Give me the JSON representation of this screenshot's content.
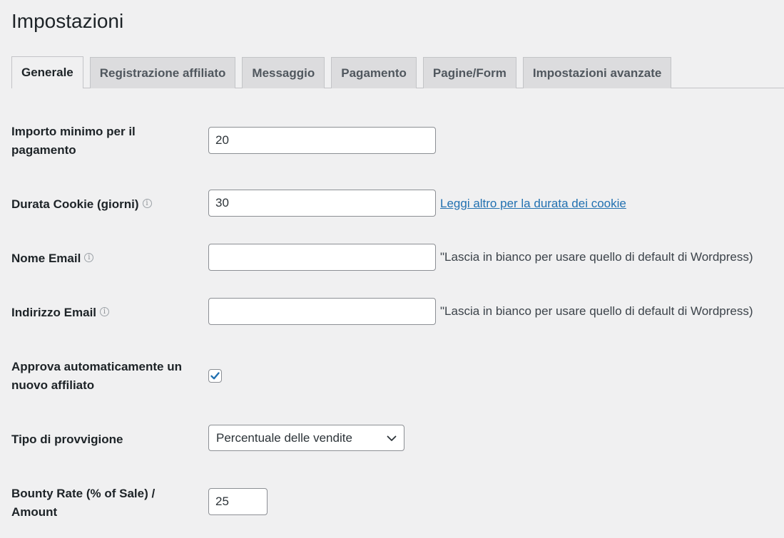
{
  "page": {
    "title": "Impostazioni"
  },
  "tabs": [
    {
      "label": "Generale",
      "active": true
    },
    {
      "label": "Registrazione affiliato"
    },
    {
      "label": "Messaggio"
    },
    {
      "label": "Pagamento"
    },
    {
      "label": "Pagine/Form"
    },
    {
      "label": "Impostazioni avanzate"
    }
  ],
  "settings": {
    "min_payout": {
      "label": "Importo minimo per il pagamento",
      "value": "20"
    },
    "cookie_duration": {
      "label": "Durata Cookie (giorni)",
      "value": "30",
      "link": "Leggi altro per la durata dei cookie"
    },
    "email_name": {
      "label": "Nome Email",
      "value": "",
      "note": "\"Lascia in bianco per usare quello di default di Wordpress)"
    },
    "email_address": {
      "label": "Indirizzo Email",
      "value": "",
      "note": "\"Lascia in bianco per usare quello di default di Wordpress)"
    },
    "auto_approve": {
      "label": "Approva automaticamente un nuovo affiliato",
      "checked": true
    },
    "commission_type": {
      "label": "Tipo di provvigione",
      "selected": "Percentuale delle vendite"
    },
    "bounty_rate": {
      "label": "Bounty Rate (% of Sale) / Amount",
      "value": "25"
    }
  },
  "icons": {
    "info": "info-icon",
    "check": "checkmark-icon",
    "chevron": "chevron-down-icon"
  },
  "colors": {
    "background": "#f0f0f1",
    "link": "#2271b1",
    "checkmark": "#2271b1",
    "tab_inactive": "#dcdcde"
  }
}
